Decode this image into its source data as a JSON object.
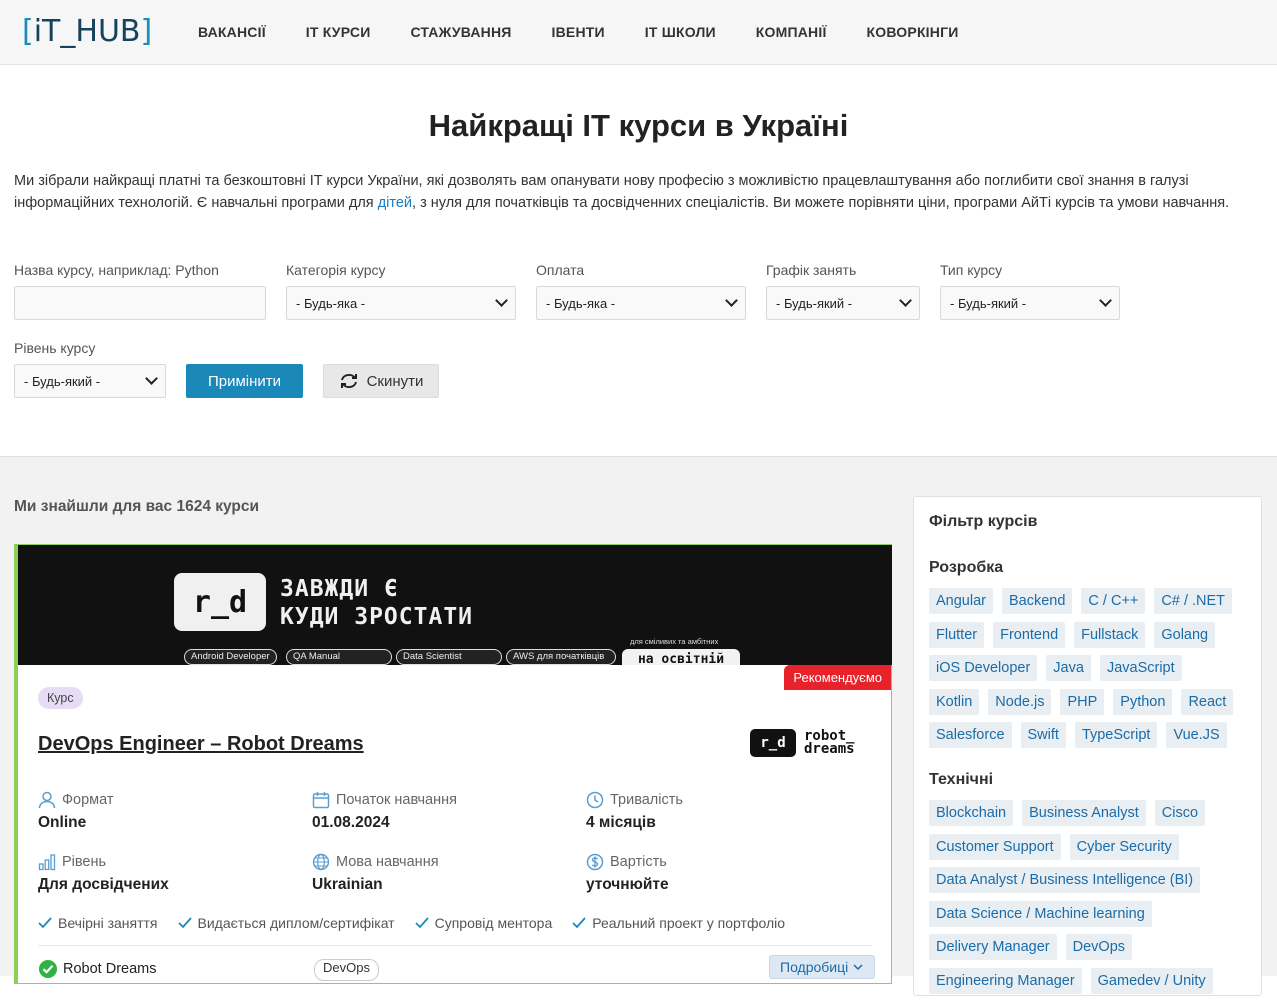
{
  "header": {
    "logo": "[iT_HUB]",
    "logo_left": "[",
    "logo_text": "iT_HUB",
    "logo_right": "]",
    "nav": [
      "ВАКАНСІЇ",
      "IT КУРСИ",
      "СТАЖУВАННЯ",
      "ІВЕНТИ",
      "IT ШКОЛИ",
      "КОМПАНІЇ",
      "КОВОРКІНГИ"
    ]
  },
  "hero": {
    "title": "Найкращі IT курси в Україні",
    "intro_part1": "Ми зібрали найкращі платні та безкоштовні IT курси України, які дозволять вам опанувати нову професію з можливістю працевлаштування або поглибити свої знання в галузі інформаційних технологій. Є навчальні програми для ",
    "intro_link": "дітей",
    "intro_part2": ", з нуля для початківців та досвідченних спеціалістів. Ви можете порівняти ціни, програми АйТі курсів та умови навчання."
  },
  "filters": {
    "name_label": "Назва курсу, наприклад: Python",
    "name_value": "",
    "category_label": "Категорія курсу",
    "category_value": "- Будь-яка -",
    "payment_label": "Оплата",
    "payment_value": "- Будь-яка -",
    "schedule_label": "Графік занять",
    "schedule_value": "- Будь-який -",
    "type_label": "Тип курсу",
    "type_value": "- Будь-який -",
    "level_label": "Рівень курсу",
    "level_value": "- Будь-який -",
    "apply_label": "Примінити",
    "reset_label": "Скинути"
  },
  "results": {
    "found_text": "Ми знайшли для вас 1624 курси"
  },
  "card": {
    "banner": {
      "logo": "r_d",
      "headline_line1": "ЗАВЖДИ Є",
      "headline_line2": "КУДИ ЗРОСТАТИ",
      "pills": [
        "Android Developer",
        "QA Manual",
        "Data Scientist",
        "AWS для початківців"
      ],
      "small_text": "для сміливих та амбітних",
      "white_text": "на освітній"
    },
    "recommend_badge": "Рекомендуємо",
    "type_tag": "Курс",
    "title": "DevOps Engineer – Robot Dreams",
    "school_logo_mark": "r_d",
    "school_logo_line1": "robot_",
    "school_logo_line2": "dreams",
    "meta": [
      {
        "label": "Формат",
        "value": "Online",
        "icon": "user-icon"
      },
      {
        "label": "Початок навчання",
        "value": "01.08.2024",
        "icon": "calendar-icon"
      },
      {
        "label": "Тривалість",
        "value": "4 місяців",
        "icon": "clock-icon"
      },
      {
        "label": "Рівень",
        "value": "Для досвідчених",
        "icon": "bar-chart-icon"
      },
      {
        "label": "Мова навчання",
        "value": "Ukrainian",
        "icon": "globe-icon"
      },
      {
        "label": "Вартість",
        "value": "уточнюйте",
        "icon": "dollar-icon"
      }
    ],
    "features": [
      "Вечірні заняття",
      "Видається диплом/сертифікат",
      "Супровід ментора",
      "Реальний проект у портфоліо"
    ],
    "school_name": "Robot Dreams",
    "category_tag": "DevOps",
    "details_button": "Подробиці"
  },
  "sidebar": {
    "title": "Фільтр курсів",
    "sections": [
      {
        "name": "Розробка",
        "tags": [
          "Angular",
          "Backend",
          "C / C++",
          "C# / .NET",
          "Flutter",
          "Frontend",
          "Fullstack",
          "Golang",
          "iOS Developer",
          "Java",
          "JavaScript",
          "Kotlin",
          "Node.js",
          "PHP",
          "Python",
          "React",
          "Salesforce",
          "Swift",
          "TypeScript",
          "Vue.JS"
        ]
      },
      {
        "name": "Технічні",
        "tags": [
          "Blockchain",
          "Business Analyst",
          "Cisco",
          "Customer Support",
          "Cyber Security",
          "Data Analyst / Business Intelligence (BI)",
          "Data Science / Machine learning",
          "Delivery Manager",
          "DevOps",
          "Engineering Manager",
          "Gamedev / Unity"
        ]
      }
    ]
  },
  "colors": {
    "accent": "#1a88b8",
    "recommend": "#e8222a",
    "card_border": "#8fce5a",
    "check": "#1a88b8"
  }
}
